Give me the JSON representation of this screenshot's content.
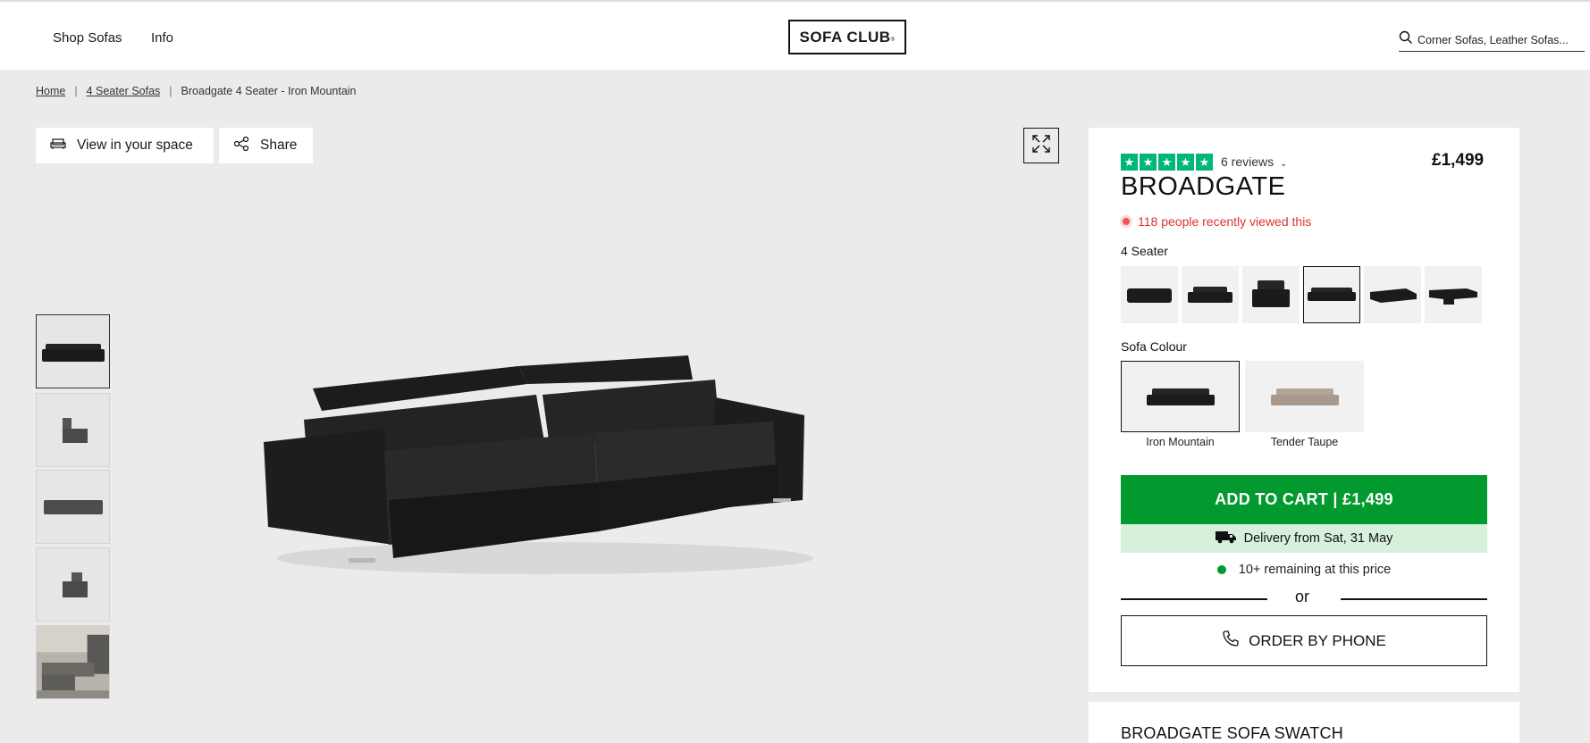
{
  "header": {
    "nav": [
      "Shop Sofas",
      "Info"
    ],
    "logo": "SOFA CLUB",
    "search_placeholder": "Corner Sofas, Leather Sofas..."
  },
  "breadcrumb": {
    "items": [
      "Home",
      "4 Seater Sofas"
    ],
    "current": "Broadgate 4 Seater - Iron Mountain",
    "separator": "|"
  },
  "toolbar": {
    "view_space_label": "View in your space",
    "share_label": "Share"
  },
  "gallery": {
    "thumbnails": [
      "sofa-front",
      "sofa-side",
      "sofa-front-low",
      "sofa-side-low",
      "sofa-lifestyle-room"
    ],
    "selected_index": 0
  },
  "product": {
    "rating_stars": 5,
    "reviews_label": "6 reviews",
    "price": "£1,499",
    "title": "BROADGATE",
    "recently_viewed": "118 people recently viewed this",
    "size_label": "4 Seater",
    "size_options_count": 6,
    "size_selected_index": 3,
    "colour_label": "Sofa Colour",
    "colours": [
      {
        "name": "Iron Mountain",
        "color": "#1c1a1b",
        "selected": true
      },
      {
        "name": "Tender Taupe",
        "color": "#a8998c",
        "selected": false
      }
    ],
    "add_to_cart": "ADD TO CART | £1,499",
    "delivery": "Delivery from Sat, 31 May",
    "remaining": "10+ remaining at this price",
    "or": "or",
    "order_by_phone": "ORDER BY PHONE",
    "swatch_title": "BROADGATE SOFA SWATCH"
  },
  "colors": {
    "cart_green": "#029a2f",
    "delivery_bg": "#d6f0dc",
    "trustpilot_green": "#00b67a",
    "alert_red": "#dd3333"
  }
}
